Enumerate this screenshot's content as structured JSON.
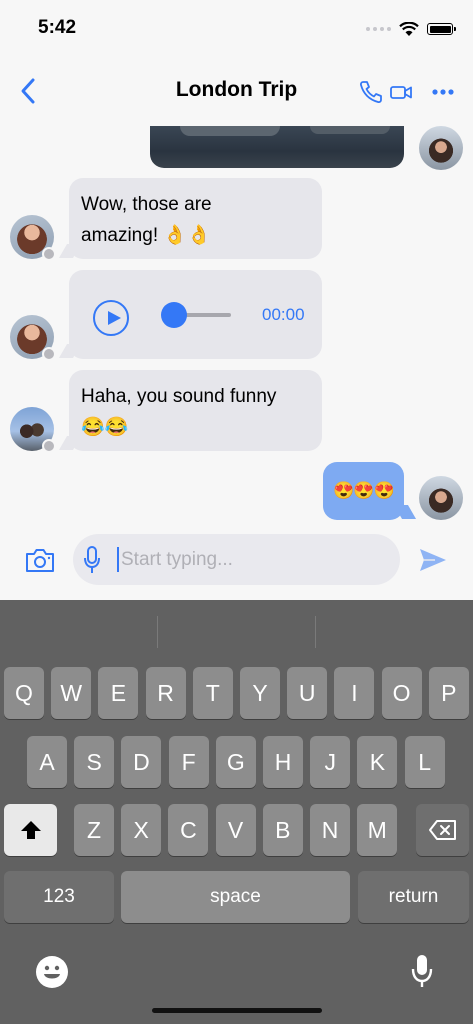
{
  "status": {
    "time": "5:42"
  },
  "header": {
    "title": "London Trip"
  },
  "messages": {
    "m1": {
      "line1": "Wow, those are",
      "line2": "amazing! 👌👌"
    },
    "audio": {
      "time": "00:00",
      "progress": 0
    },
    "m2": {
      "line1": "Haha, you sound funny",
      "line2": "😂😂"
    },
    "mine": {
      "text": "😍😍😍"
    }
  },
  "composer": {
    "placeholder": "Start typing..."
  },
  "keyboard": {
    "row1": [
      "Q",
      "W",
      "E",
      "R",
      "T",
      "Y",
      "U",
      "I",
      "O",
      "P"
    ],
    "row2": [
      "A",
      "S",
      "D",
      "F",
      "G",
      "H",
      "J",
      "K",
      "L"
    ],
    "row3": [
      "Z",
      "X",
      "C",
      "V",
      "B",
      "N",
      "M"
    ],
    "numbers_label": "123",
    "space_label": "space",
    "return_label": "return"
  },
  "colors": {
    "accent": "#3478f6",
    "incoming_bubble": "#e6e6eb",
    "outgoing_bubble": "#7eaaf2",
    "keyboard_bg": "#616161"
  }
}
